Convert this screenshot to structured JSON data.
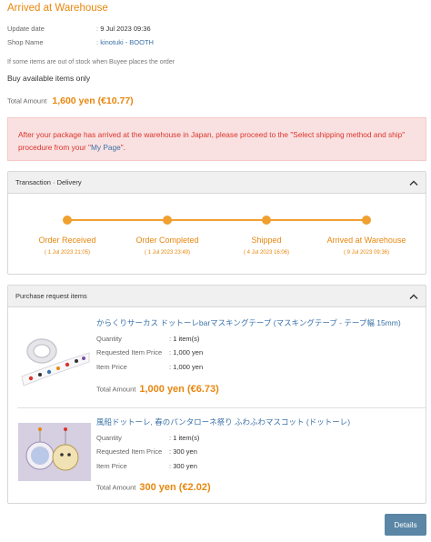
{
  "page": {
    "title": "Arrived at Warehouse"
  },
  "info": {
    "update_date_label": "Update date",
    "update_date_value": "9 Jul 2023 09:36",
    "shop_name_label": "Shop Name",
    "shop_name_value": "kinotuki - BOOTH",
    "separator": ":"
  },
  "stock_note": "If some items are out of stock when Buyee places the order",
  "stock_option": "Buy available items only",
  "total": {
    "label": "Total Amount",
    "value": "1,600 yen (€10.77)"
  },
  "alert": {
    "text_before": "After your package has arrived at the warehouse in Japan, please proceed to the \"Select shipping method and ship\" procedure from your \"",
    "link": "My Page",
    "text_after": "\"."
  },
  "transaction": {
    "title": "Transaction · Delivery",
    "steps": [
      {
        "name": "Order Received",
        "date": "( 1 Jul 2023 21:05)"
      },
      {
        "name": "Order Completed",
        "date": "( 1 Jul 2023 23:49)"
      },
      {
        "name": "Shipped",
        "date": "( 4 Jul 2023 16:06)"
      },
      {
        "name": "Arrived at Warehouse",
        "date": "( 9 Jul 2023 09:36)"
      }
    ]
  },
  "purchase": {
    "title": "Purchase request items",
    "labels": {
      "quantity": "Quantity",
      "requested_price": "Requested Item Price",
      "item_price": "Item Price",
      "total_amount": "Total Amount",
      "separator": ":"
    },
    "items": [
      {
        "name": "からくりサーカス ドットーレbarマスキングテープ (マスキングテープ - テープ幅 15mm)",
        "quantity": "1 item(s)",
        "requested_price": "1,000 yen",
        "item_price": "1,000 yen",
        "total": "1,000 yen (€6.73)"
      },
      {
        "name": "風船ドットーレ, 春のパンタローネ祭り ふわふわマスコット (ドットーレ)",
        "quantity": "1 item(s)",
        "requested_price": "300 yen",
        "item_price": "300 yen",
        "total": "300 yen (€2.02)"
      }
    ]
  },
  "buttons": {
    "details": "Details"
  },
  "colors": {
    "accent": "#e8870e",
    "link": "#3b72a8",
    "alert_bg": "#fae1e1",
    "alert_text": "#d9342c",
    "button": "#5b86a5"
  }
}
